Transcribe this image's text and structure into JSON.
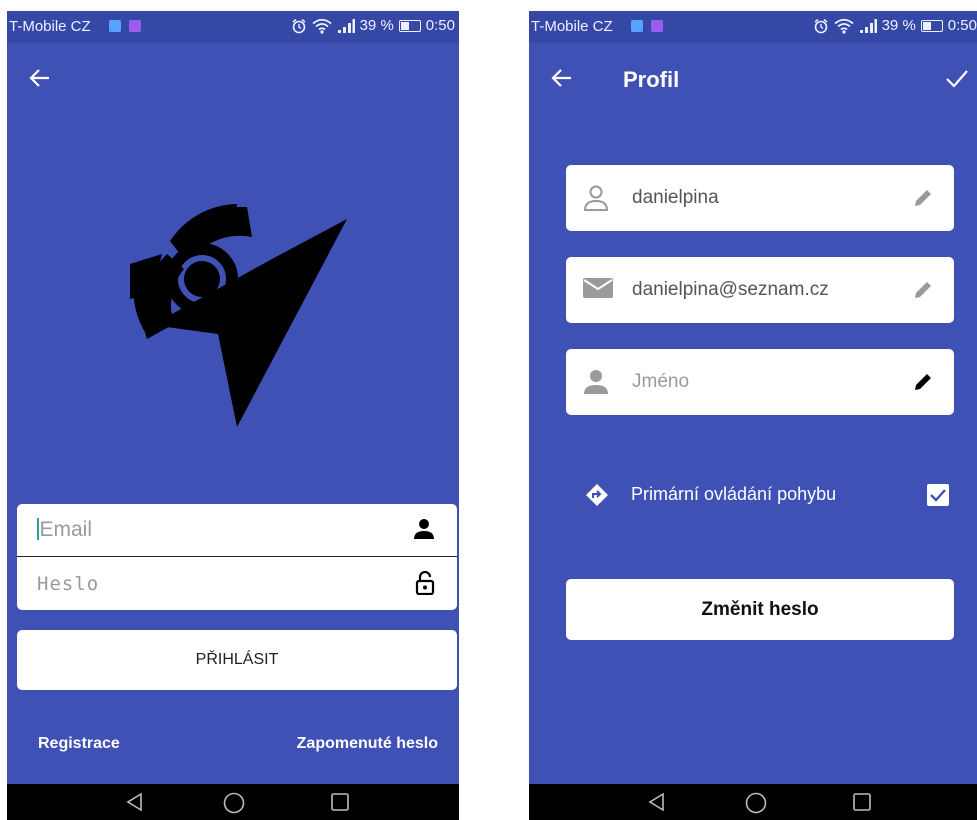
{
  "colors": {
    "primary": "#3f51b5",
    "status_bar": "#3648a6",
    "card": "#ffffff",
    "accent": "#26a69a",
    "checkbox_check": "#3f51b5"
  },
  "status_bar": {
    "carrier": "T-Mobile CZ",
    "battery_percent": "39 %",
    "time": "0:50",
    "battery_level": 0.39
  },
  "login_screen": {
    "email_placeholder": "Email",
    "password_placeholder": "Heslo",
    "login_button": "PŘIHLÁSIT",
    "register_link": "Registrace",
    "forgot_password_link": "Zapomenuté heslo"
  },
  "profile_screen": {
    "title": "Profil",
    "username": "danielpina",
    "email": "danielpina@seznam.cz",
    "name_placeholder": "Jméno",
    "primary_motion_label": "Primární ovládání pohybu",
    "primary_motion_checked": true,
    "change_password_button": "Změnit heslo"
  },
  "icons": {
    "back": "arrow-left-icon",
    "confirm": "check-icon",
    "user": "person-icon",
    "lock": "unlock-icon",
    "mail": "mail-icon",
    "edit": "pencil-icon",
    "directions": "directions-icon",
    "alarm": "alarm-icon",
    "wifi": "wifi-icon",
    "signal": "signal-icon"
  }
}
